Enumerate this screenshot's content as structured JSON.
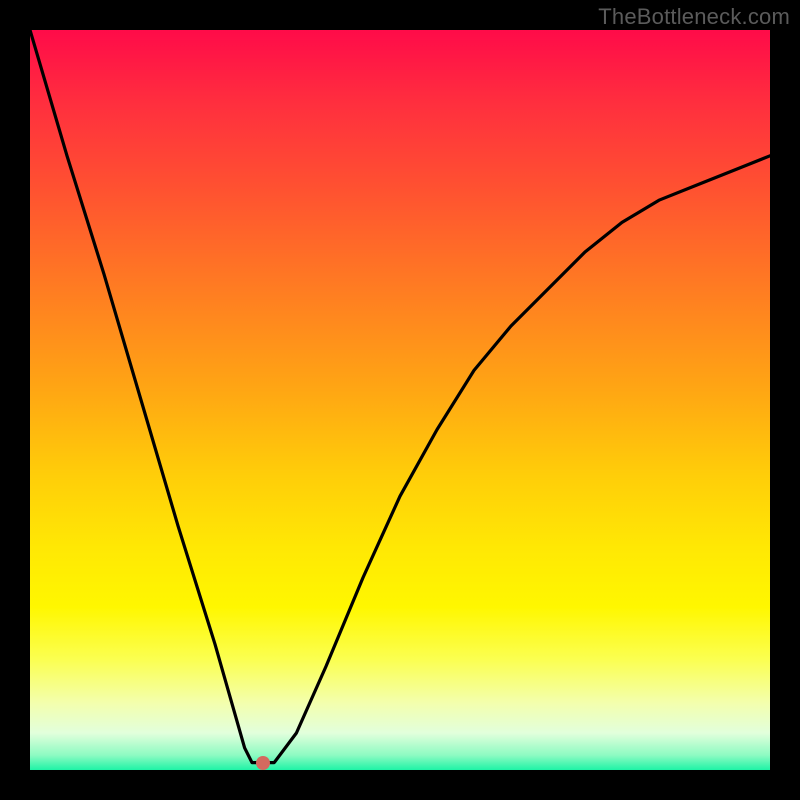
{
  "watermark": "TheBottleneck.com",
  "chart_data": {
    "type": "line",
    "title": "",
    "xlabel": "",
    "ylabel": "",
    "xlim": [
      0,
      1
    ],
    "ylim": [
      0,
      1
    ],
    "series": [
      {
        "name": "curve",
        "x": [
          0.0,
          0.05,
          0.1,
          0.15,
          0.2,
          0.25,
          0.29,
          0.3,
          0.33,
          0.36,
          0.4,
          0.45,
          0.5,
          0.55,
          0.6,
          0.65,
          0.7,
          0.75,
          0.8,
          0.85,
          0.9,
          0.95,
          1.0
        ],
        "y": [
          1.0,
          0.83,
          0.67,
          0.5,
          0.33,
          0.17,
          0.03,
          0.01,
          0.01,
          0.05,
          0.14,
          0.26,
          0.37,
          0.46,
          0.54,
          0.6,
          0.65,
          0.7,
          0.74,
          0.77,
          0.79,
          0.81,
          0.83
        ]
      }
    ],
    "marker": {
      "x": 0.315,
      "y": 0.01
    },
    "colors": {
      "curve": "#000000",
      "gradient_top": "#ff0b49",
      "gradient_bottom": "#1ef3a6",
      "marker": "#d46a5f",
      "watermark": "#5b5b5b",
      "frame": "#000000"
    }
  }
}
